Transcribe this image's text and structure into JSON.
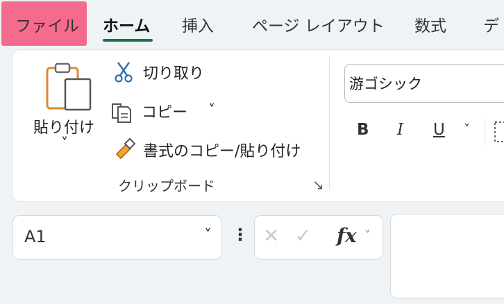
{
  "tabs": [
    {
      "label": "ファイル"
    },
    {
      "label": "ホーム"
    },
    {
      "label": "挿入"
    },
    {
      "label": "ページ レイアウト"
    },
    {
      "label": "数式"
    },
    {
      "label": "デ"
    }
  ],
  "clipboard": {
    "paste_label_line1": "貼り付け",
    "paste_dropdown": "˅",
    "cut_label": "切り取り",
    "copy_label": "コピー",
    "copy_dropdown": "˅",
    "format_painter_label": "書式のコピー/貼り付け",
    "group_label": "クリップボード",
    "launcher": "↘"
  },
  "font": {
    "name": "游ゴシック",
    "bold": "B",
    "italic": "I",
    "underline": "U",
    "underline_dropdown": "˅"
  },
  "formula_bar": {
    "name_box_value": "A1",
    "name_box_dropdown": "˅",
    "more": "⋮",
    "cancel": "✕",
    "enter": "✓",
    "fx": "fx",
    "fx_dropdown": "˅"
  },
  "colors": {
    "file_highlight": "#f56b8d",
    "home_underline": "#1f6f44",
    "paste_icon": "#d98b2b",
    "cut_icon": "#2f6fb5"
  }
}
